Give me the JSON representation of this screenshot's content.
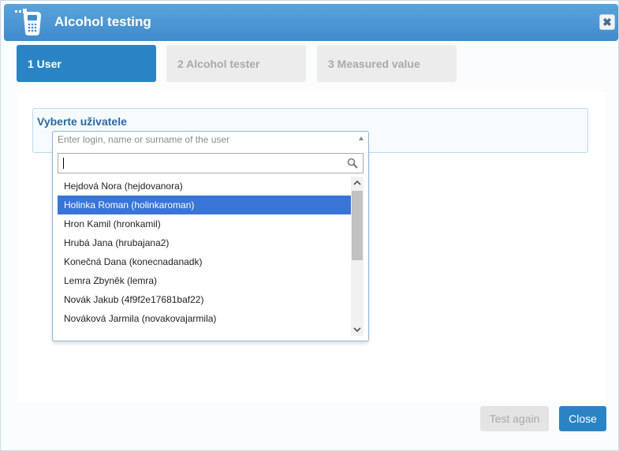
{
  "window": {
    "title": "Alcohol testing",
    "close_symbol": "✖"
  },
  "steps": [
    {
      "label": "1 User",
      "state": "active"
    },
    {
      "label": "2 Alcohol tester",
      "state": "inactive"
    },
    {
      "label": "3 Measured value",
      "state": "inactive"
    }
  ],
  "user_field": {
    "label": "Vyberte uživatele",
    "placeholder": "Enter login, name or surname of the user",
    "search_value": "",
    "options": [
      "Hejdová Nora (hejdovanora)",
      "Holinka Roman (holinkaroman)",
      "Hron Kamil (hronkamil)",
      "Hrubá Jana (hrubajana2)",
      "Konečná Dana (konecnadanadk)",
      "Lemra Zbyněk (lemra)",
      "Novák Jakub (4f9f2e17681baf22)",
      "Nováková Jarmila (novakovajarmila)"
    ],
    "selected_index": 1
  },
  "buttons": {
    "test_again": "Test again",
    "close": "Close"
  },
  "colors": {
    "accent": "#2a84c4",
    "header": "#4a97d4",
    "selected_row": "#3875d7",
    "label": "#2a6aa4"
  },
  "icons": {
    "title": "breathalyzer-icon",
    "close": "close-icon",
    "search": "search-icon",
    "dropdown": "arrow-up-icon"
  }
}
